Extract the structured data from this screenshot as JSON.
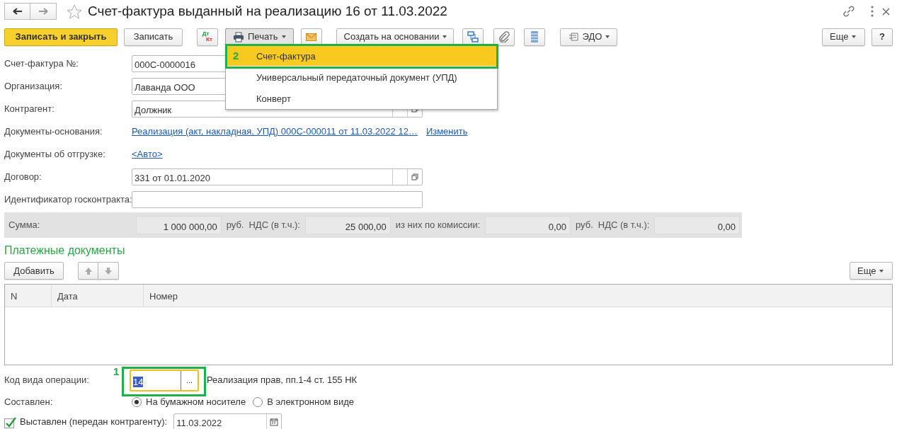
{
  "window": {
    "title": "Счет-фактура выданный на реализацию 16 от 11.03.2022"
  },
  "toolbar": {
    "save_close": "Записать и закрыть",
    "save": "Записать",
    "dt": "Дт",
    "kt": "Кт",
    "print": "Печать",
    "create_based": "Создать на основании",
    "edo": "ЭДО",
    "more": "Еще",
    "help": "?"
  },
  "print_menu": {
    "items": [
      {
        "label": "Счет-фактура",
        "selected": true,
        "marker": "2"
      },
      {
        "label": "Универсальный передаточный документ (УПД)",
        "selected": false
      },
      {
        "label": "Конверт",
        "selected": false
      }
    ]
  },
  "fields": [
    {
      "kind": "input",
      "label": "Счет-фактура №:",
      "value": "000С-0000016"
    },
    {
      "kind": "input",
      "label": "Организация:",
      "value": "Лаванда ООО"
    },
    {
      "kind": "select",
      "label": "Контрагент:",
      "value": "Должник"
    },
    {
      "kind": "links",
      "label": "Документы-основания:",
      "links": [
        "Реализация (акт, накладная, УПД) 000С-000011 от 11.03.2022 12…",
        "Изменить"
      ]
    },
    {
      "kind": "links",
      "label": "Документы об отгрузке:",
      "links": [
        "<Авто>"
      ]
    },
    {
      "kind": "select",
      "label": "Договор:",
      "value": "331 от 01.01.2020"
    },
    {
      "kind": "input",
      "label": "Идентификатор госконтракта:"
    }
  ],
  "totals": [
    {
      "kind": "label",
      "text": "Сумма:"
    },
    {
      "kind": "value",
      "text": "1 000 000,00"
    },
    {
      "kind": "label",
      "text": "руб."
    },
    {
      "kind": "label",
      "text": "НДС (в т.ч.):"
    },
    {
      "kind": "value",
      "text": "25 000,00"
    },
    {
      "kind": "label",
      "text": "из них по комиссии:"
    },
    {
      "kind": "value",
      "text": "0,00"
    },
    {
      "kind": "label",
      "text": "руб."
    },
    {
      "kind": "label",
      "text": "НДС (в т.ч.):"
    },
    {
      "kind": "value",
      "text": "0,00"
    }
  ],
  "payments": {
    "title": "Платежные документы",
    "add": "Добавить",
    "more": "Еще",
    "columns": [
      "N",
      "Дата",
      "Номер"
    ]
  },
  "op_code": {
    "label": "Код вида операции:",
    "value": "14",
    "marker": "1",
    "button": "...",
    "description": "Реализация прав, пп.1-4 ст. 155 НК"
  },
  "composed": {
    "label": "Составлен:",
    "options": [
      {
        "label": "На бумажном носителе",
        "selected": true
      },
      {
        "label": "В электронном виде",
        "selected": false
      }
    ]
  },
  "issued": {
    "label": "Выставлен (передан контрагенту):",
    "checked": true,
    "date": "11.03.2022"
  }
}
